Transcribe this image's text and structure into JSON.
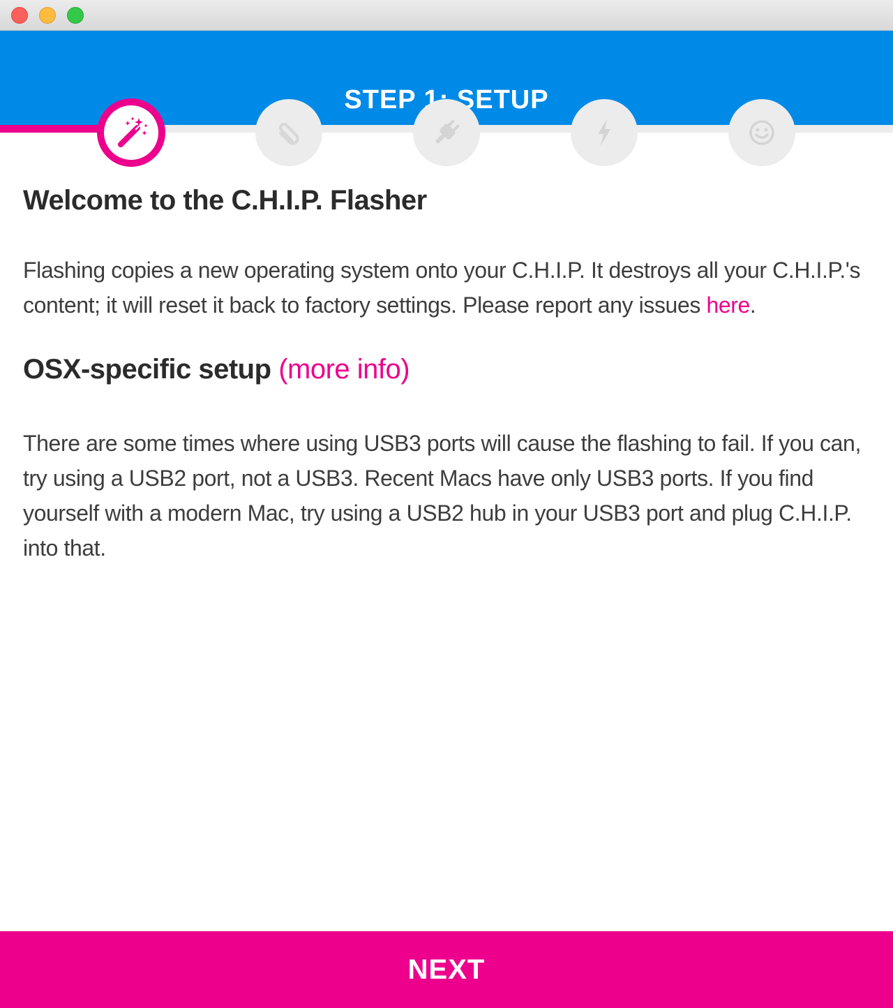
{
  "window": {
    "controls": [
      "close",
      "minimize",
      "zoom"
    ]
  },
  "header": {
    "title": "STEP 1: SETUP",
    "background": "#008ae8"
  },
  "progress": {
    "active_step": 1,
    "steps": [
      {
        "icon": "magic-wand-icon",
        "state": "active"
      },
      {
        "icon": "paperclip-icon",
        "state": "inactive"
      },
      {
        "icon": "plug-icon",
        "state": "inactive"
      },
      {
        "icon": "lightning-icon",
        "state": "inactive"
      },
      {
        "icon": "smiley-icon",
        "state": "inactive"
      }
    ],
    "accent": "#ec008c",
    "inactive_color": "#ececec"
  },
  "content": {
    "welcome_title": "Welcome to the C.H.I.P. Flasher",
    "intro_text": "Flashing copies a new operating system onto your C.H.I.P. It destroys all your C.H.I.P.'s content; it will reset it back to factory settings. Please report any issues ",
    "intro_link": "here",
    "intro_end": ".",
    "osx_title": "OSX-specific setup",
    "osx_link": "(more info)",
    "usb_text": "There are some times where using USB3 ports will cause the flashing to fail. If you can, try using a USB2 port, not a USB3. Recent Macs have only USB3 ports. If you find yourself with a modern Mac, try using a USB2 hub in your USB3 port and plug C.H.I.P. into that."
  },
  "footer": {
    "next_label": "NEXT"
  }
}
